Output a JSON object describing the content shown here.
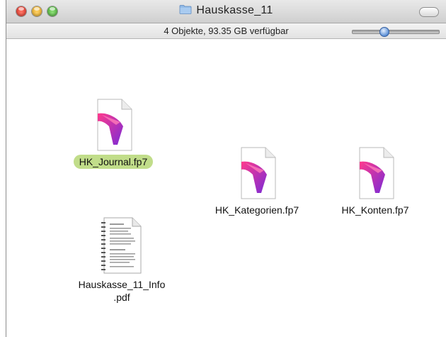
{
  "window": {
    "title": "Hauskasse_11",
    "status": "4 Objekte, 93.35 GB verfügbar",
    "icon": "folder-icon"
  },
  "files": [
    {
      "name": "HK_Journal.fp7",
      "icon": "filemaker-document-icon",
      "selected": true
    },
    {
      "name": "HK_Kategorien.fp7",
      "icon": "filemaker-document-icon",
      "selected": false
    },
    {
      "name": "HK_Konten.fp7",
      "icon": "filemaker-document-icon",
      "selected": false
    },
    {
      "name": "Hauskasse_11_Info\n.pdf",
      "icon": "pdf-document-icon",
      "selected": false
    }
  ],
  "colors": {
    "selection": "#c1dd8a",
    "filemaker_pink": "#e8308c",
    "filemaker_purple": "#8a2fd0"
  }
}
